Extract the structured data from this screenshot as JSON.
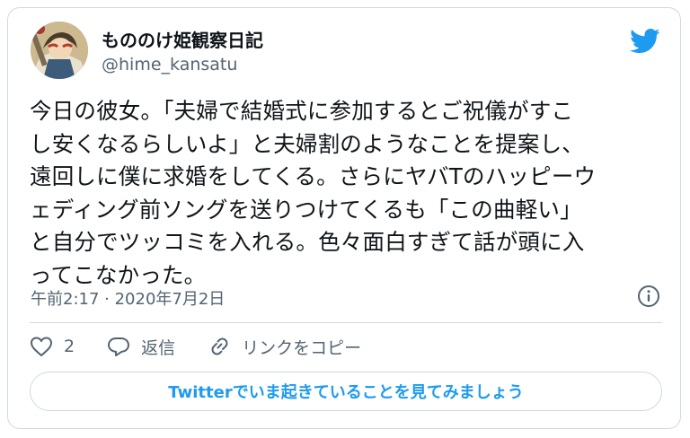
{
  "author": {
    "display_name": "もののけ姫観察日記",
    "handle": "@hime_kansatu"
  },
  "tweet": {
    "lines": [
      "今日の彼女。「夫婦で結婚式に参加するとご祝儀がすこ",
      "し安くなるらしいよ」と夫婦割のようなことを提案し、",
      "遠回しに僕に求婚をしてくる。さらにヤバTのハッピーウ",
      "ェディング前ソングを送りつけてくるも「この曲軽い」",
      "と自分でツッコミを入れる。色々面白すぎて話が頭に入",
      "ってこなかった。"
    ],
    "timestamp": "午前2:17 · 2020年7月2日"
  },
  "actions": {
    "like_count": "2",
    "reply_label": "返信",
    "copy_link_label": "リンクをコピー"
  },
  "cta": {
    "label": "Twitterでいま起きていることを見てみましょう"
  },
  "icons": {
    "logo": "twitter-bird-icon",
    "info": "info-icon",
    "like": "heart-icon",
    "reply": "speech-bubble-icon",
    "link": "link-icon"
  },
  "colors": {
    "brand": "#1d9bf0",
    "text": "#0f1419",
    "secondary": "#536471",
    "border": "#cfd9de"
  }
}
